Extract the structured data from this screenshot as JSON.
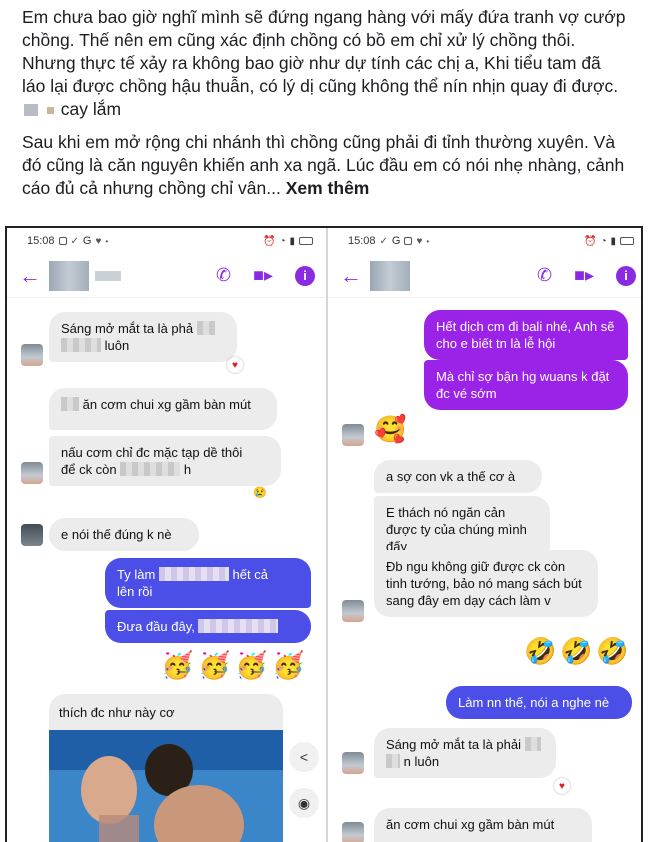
{
  "post": {
    "para1_a": "Em chưa bao giờ nghĩ mình sẽ đứng ngang hàng với mấy đứa tranh vợ cướp chồng. Thế nên em cũng xác định chồng có bồ em chỉ xử lý chồng thôi. Nhưng thực tế xảy ra không bao giờ như dự tính các chị a, Khi tiểu tam đã láo lại được chồng hậu thuẫn, có lý dị cũng không thể nín nhịn quay đi được.",
    "para1_b": "cay lắm",
    "para2": "Sau khi em mở rộng chi nhánh thì chồng cũng phải đi tỉnh thường xuyên. Và đó cũng là căn nguyên khiến anh xa ngã. Lúc đầu em có nói nhẹ nhàng, cảnh cáo đủ cả nhưng chồng chỉ vân...",
    "see_more": "Xem thêm"
  },
  "left_phone": {
    "time": "15:08",
    "status_letters": "G",
    "messages": {
      "m1": "Sáng mở mắt ta là phả",
      "m1b": "luôn",
      "m2": "ăn cơm chui xg gầm bàn mút",
      "m3a": "nấu cơm chỉ đc mặc tạp dề thôi",
      "m3b": "để ck còn",
      "m3c": "h",
      "m4": "e nói thế đúng k nè",
      "m5a": "Ty làm",
      "m5b": "hết cả",
      "m5c": "lên rồi",
      "m6": "Đưa đầu đây,",
      "m7": "thích đc như này cơ"
    },
    "emoji_row": [
      "🥳",
      "🥳",
      "🥳",
      "🥳"
    ]
  },
  "right_phone": {
    "time": "15:08",
    "status_letters": "G",
    "messages": {
      "m1": "Hết dịch cm đi bali nhé, Anh sẽ cho e biết tn là lễ hội",
      "m2": "Mà chỉ sợ bận hg wuans k đặt đc vé sớm",
      "m3": "a sợ con vk a thế cơ à",
      "m4": "E thách nó ngăn cản được ty của chúng mình đấy",
      "m5": "Đb ngu không giữ được ck còn tinh tướng, bảo nó mang sách bút sang đây em dạy cách làm v",
      "m6": "Làm nn thế, nói a nghe nè",
      "m7a": "Sáng mở mắt ta là phải",
      "m7b": "n luôn",
      "m8": "ăn cơm chui xg gầm bàn mút"
    },
    "sticker": "🥰",
    "emoji_row": [
      "🤣",
      "🤣",
      "🤣"
    ]
  },
  "icons": {
    "back": "back-arrow-icon",
    "phone": "phone-icon",
    "video": "video-camera-icon",
    "info": "info-icon",
    "share": "share-icon",
    "camera": "camera-icon",
    "heart": "heart-reaction-icon"
  },
  "colors": {
    "accent": "#8a2be2",
    "bubble_blue": "#4b4fe8",
    "bubble_purple": "#9b23e8",
    "bubble_in": "#ececec"
  }
}
